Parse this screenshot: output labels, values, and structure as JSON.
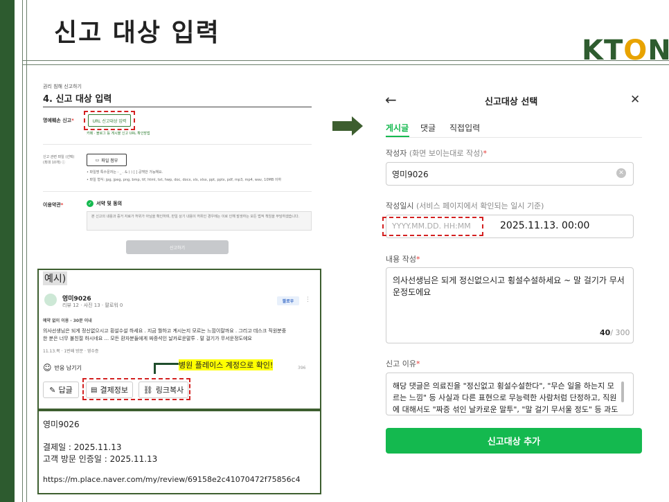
{
  "slide": {
    "title": "신고 대상 입력",
    "logo_left": "KT",
    "logo_dot": "O",
    "logo_right": "N"
  },
  "form": {
    "breadcrumb": "권리 침해 신고하기",
    "section_title": "4. 신고 대상 입력",
    "defamation_label": "명예훼손 신고",
    "url_button": "URL 신고대상 입력",
    "url_help": "카페 · 블로그 등 게시물 신고 URL 확인방법",
    "file_label": "신고 관련 파일 (선택)",
    "file_sub": "(최대 10개) ⓘ",
    "file_button": "파일 첨부",
    "file_note1": "• 파일명 특수문자는 - _ . & ( ) [ ] 공백만 가능해요.",
    "file_note2": "• 파일 형식: jpg, jpeg, png, bmp, tif, html, txt, hwp, doc, docx, xls, xlsx, ppt, pptx, pdf, mp3, mp4, wav, 10MB 이하",
    "terms_label": "이용약관",
    "agree_label": "서약 및 동의",
    "agree_text": "본 신고의 내용과 증거 자료가 허위가 아님을 확인하며, 만일 상기 내용이 허위인 경우에는 이로 인해 발생하는 모든 법적 책임을 부담하겠습니다.",
    "submit": "신고하기"
  },
  "example": {
    "label": "예시)",
    "user_name": "영미9026",
    "user_meta": "리뷰 12 · 사진 13 · 팔로워 0",
    "follow": "팔로우",
    "wait": "예약 없이 이용 · 30분 이내",
    "review_line1": "의사선생님은 되게 정신없으시고 횡설수설 하세요 . 지금 뭘하고 계시는지 모르는 느낌이랄까요 . 그리고 데스크 직원분중",
    "review_line2": "한 분은 너무 불친절 하시네요 ... 모든 환자분들에게 짜증석인 날카로운말투 . 말 걸기가 무서운정도에요",
    "visit_meta": "11.13.목 · 1번째 방문 · 영수증",
    "reaction": "반응 남기기",
    "count": "396",
    "callout": "병원 플레이스 계정으로 확인!",
    "reply_btn": "답글",
    "payment_btn": "결제정보",
    "link_btn": "링크복사"
  },
  "info": {
    "name": "영미9026",
    "pay_date": "결제일 : 2025.11.13",
    "visit_date": "고객 방문 인증일 : 2025.11.13",
    "url": "https://m.place.naver.com/my/review/69158e2c41070472f75856c4"
  },
  "modal": {
    "back": "←",
    "title": "신고대상 선택",
    "close": "✕",
    "tabs": [
      "게시글",
      "댓글",
      "직접입력"
    ],
    "author_label": "작성자",
    "author_hint": "(화면 보이는대로 작성)",
    "author_value": "영미9026",
    "date_label": "작성일시",
    "date_hint": "(서비스 페이지에서 확인되는 일시 기준)",
    "date_placeholder": "YYYY.MM.DD. HH:MM",
    "date_value": "2025.11.13. 00:00",
    "content_label": "내용 작성",
    "content_value": "의사선생님은 되게 정신없으시고 횡설수설하세요 ~ 말 걸기가 무서운정도에요",
    "char_count": "40",
    "char_max": "/ 300",
    "reason_label": "신고 이유",
    "reason_value": "해당 댓글은 의료진을 \"정신없고 횡설수설한다\", \"무슨 일을 하는지 모르는 느낌\" 등 사실과 다른 표현으로 무능력한 사람처럼 단정하고, 직원에 대해서도 \"짜증 섞인 날카로운 말투\", \"말 걸기 무서울 정도\" 등 과도한 비난을",
    "add_button": "신고대상 추가"
  },
  "colors": {
    "brand_green": "#2d5b2f",
    "accent_green": "#14b94f",
    "dash_red": "#d32020",
    "highlight": "#ffff00"
  }
}
